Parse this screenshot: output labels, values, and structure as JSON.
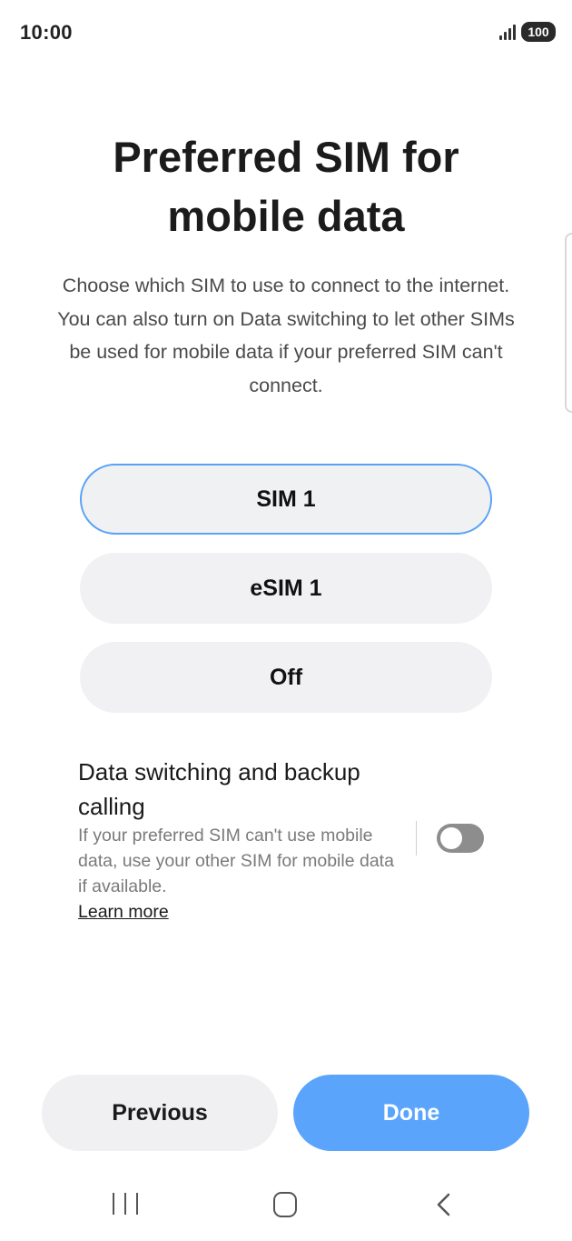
{
  "status_bar": {
    "time": "10:00",
    "battery": "100",
    "icons": [
      "signal-icon",
      "battery-icon"
    ]
  },
  "page": {
    "title": "Preferred SIM for mobile data",
    "description": "Choose which SIM to use to connect to the internet. You can also turn on Data switching to let other SIMs be used for mobile data if your preferred SIM can't connect."
  },
  "options": [
    {
      "label": "SIM 1",
      "selected": true
    },
    {
      "label": "eSIM 1",
      "selected": false
    },
    {
      "label": "Off",
      "selected": false
    }
  ],
  "data_switching": {
    "title": "Data switching and backup calling",
    "description": "If your preferred SIM can't use mobile data, use your other SIM for mobile data if available.",
    "learn_more": "Learn more",
    "enabled": false
  },
  "buttons": {
    "previous": "Previous",
    "done": "Done"
  },
  "nav_bar": {
    "icons": [
      "recents-icon",
      "home-icon",
      "back-icon"
    ]
  },
  "colors": {
    "accent": "#5aa5fb",
    "selected_border": "#5aa2f5",
    "option_bg": "#f1f1f3",
    "toggle_off": "#8d8d8d"
  }
}
